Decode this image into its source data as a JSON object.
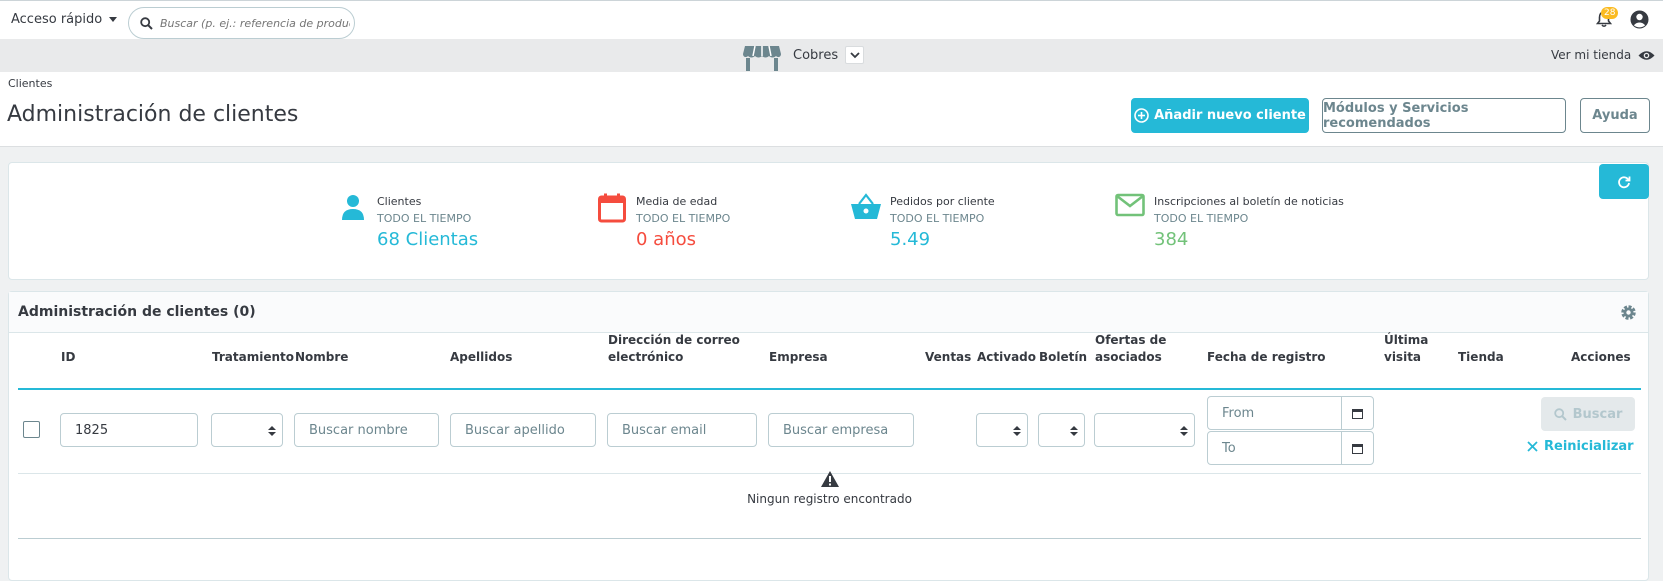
{
  "header": {
    "quick_access": "Acceso rápido",
    "search_placeholder": "Buscar (p. ej.: referencia de producto,",
    "notifications_count": "28"
  },
  "shopbar": {
    "shop_name": "Cobres",
    "view_shop": "Ver mi tienda"
  },
  "pagehead": {
    "breadcrumb": "Clientes",
    "title": "Administración de clientes",
    "add_button": "Añadir nuevo cliente",
    "modules_button": "Módulos y Servicios recomendados",
    "help_button": "Ayuda"
  },
  "kpis": [
    {
      "label": "Clientes",
      "sub": "TODO EL TIEMPO",
      "value": "68 Clientas",
      "color": "#25b9d7"
    },
    {
      "label": "Media de edad",
      "sub": "TODO EL TIEMPO",
      "value": "0 años",
      "color": "#f54c3e"
    },
    {
      "label": "Pedidos por cliente",
      "sub": "TODO EL TIEMPO",
      "value": "5.49",
      "color": "#25b9d7"
    },
    {
      "label": "Inscripciones al boletín de noticias",
      "sub": "TODO EL TIEMPO",
      "value": "384",
      "color": "#72c279"
    }
  ],
  "list": {
    "title": "Administración de clientes (0)",
    "columns": {
      "id": "ID",
      "title": "Tratamiento",
      "firstname": "Nombre",
      "lastname": "Apellidos",
      "email_1": "Dirección de correo",
      "email_2": "electrónico",
      "company": "Empresa",
      "sales": "Ventas",
      "active": "Activado",
      "newsletter": "Boletín",
      "optin_1": "Ofertas de",
      "optin_2": "asociados",
      "date_add": "Fecha de registro",
      "last_visit_1": "Última",
      "last_visit_2": "visita",
      "shop": "Tienda",
      "actions": "Acciones"
    },
    "filters": {
      "id_value": "1825",
      "firstname_placeholder": "Buscar nombre",
      "lastname_placeholder": "Buscar apellido",
      "email_placeholder": "Buscar email",
      "company_placeholder": "Buscar empresa",
      "date_from": "From",
      "date_to": "To",
      "search_button": "Buscar",
      "reset_button": "Reinicializar"
    },
    "empty_message": "Ningun registro encontrado"
  }
}
